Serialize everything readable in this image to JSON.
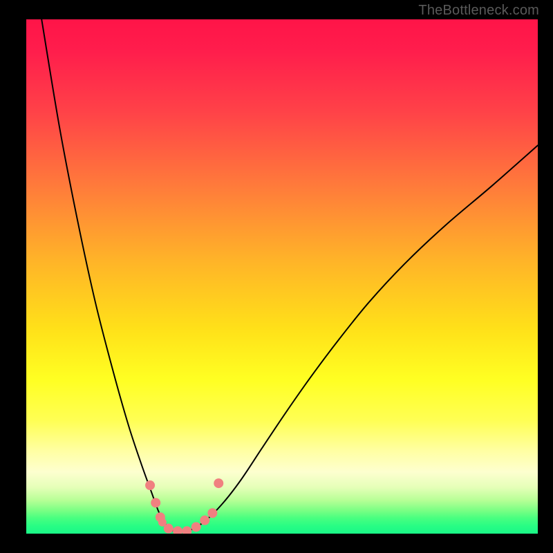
{
  "watermark": {
    "text": "TheBottleneck.com"
  },
  "chart_data": {
    "type": "line",
    "title": "",
    "xlabel": "",
    "ylabel": "",
    "xlim": [
      0,
      100
    ],
    "ylim": [
      0,
      100
    ],
    "grid": false,
    "legend": false,
    "background": {
      "kind": "vertical-gradient",
      "stops": [
        {
          "pct": 0,
          "color": "#ff1448"
        },
        {
          "pct": 33,
          "color": "#ff7d3a"
        },
        {
          "pct": 60,
          "color": "#ffe019"
        },
        {
          "pct": 88,
          "color": "#fdffcf"
        },
        {
          "pct": 100,
          "color": "#1af787"
        }
      ]
    },
    "series": [
      {
        "name": "curve",
        "color": "#000000",
        "x": [
          3.0,
          6.5,
          10.0,
          13.5,
          17.0,
          20.0,
          22.5,
          24.5,
          26.0,
          27.5,
          29.0,
          32.0,
          35.0,
          38.5,
          42.0,
          46.0,
          50.5,
          55.5,
          61.0,
          67.0,
          74.0,
          82.0,
          91.0,
          100.0
        ],
        "y": [
          100.0,
          79.0,
          61.0,
          45.0,
          31.5,
          21.0,
          13.5,
          8.0,
          4.0,
          1.5,
          0.5,
          0.7,
          2.5,
          6.0,
          10.5,
          16.5,
          23.2,
          30.3,
          37.6,
          45.0,
          52.5,
          60.0,
          67.6,
          75.5
        ]
      }
    ],
    "highlight_markers": {
      "name": "bottom-cluster",
      "color": "#f08080",
      "points": [
        {
          "x": 24.2,
          "y": 9.4,
          "r": 7
        },
        {
          "x": 25.3,
          "y": 6.0,
          "r": 7
        },
        {
          "x": 26.2,
          "y": 3.2,
          "r": 7
        },
        {
          "x": 26.6,
          "y": 2.2,
          "r": 6
        },
        {
          "x": 27.8,
          "y": 1.0,
          "r": 7
        },
        {
          "x": 29.6,
          "y": 0.5,
          "r": 7
        },
        {
          "x": 31.4,
          "y": 0.5,
          "r": 7
        },
        {
          "x": 33.2,
          "y": 1.3,
          "r": 7
        },
        {
          "x": 34.9,
          "y": 2.6,
          "r": 7
        },
        {
          "x": 36.4,
          "y": 4.0,
          "r": 7
        },
        {
          "x": 37.6,
          "y": 9.8,
          "r": 7
        }
      ]
    }
  }
}
